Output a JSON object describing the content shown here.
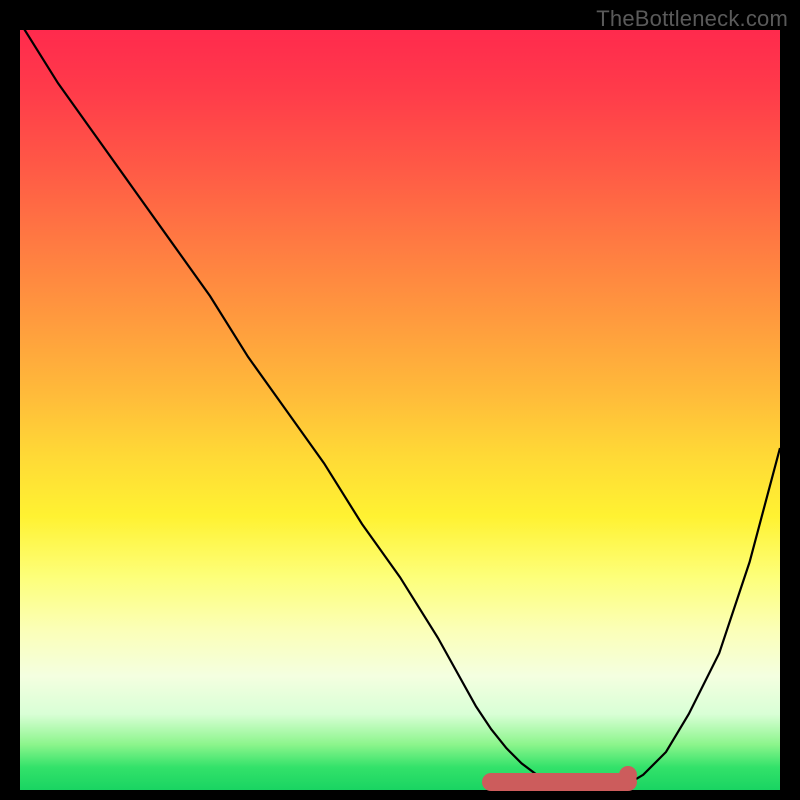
{
  "attribution": "TheBottleneck.com",
  "chart_data": {
    "type": "line",
    "title": "",
    "xlabel": "",
    "ylabel": "",
    "xlim": [
      0,
      100
    ],
    "ylim": [
      0,
      100
    ],
    "series": [
      {
        "name": "bottleneck-curve",
        "x": [
          0,
          5,
          10,
          15,
          20,
          25,
          30,
          35,
          40,
          45,
          50,
          55,
          60,
          62,
          64,
          66,
          68,
          70,
          72,
          74,
          76,
          78,
          80,
          82,
          85,
          88,
          92,
          96,
          100
        ],
        "y": [
          101,
          93,
          86,
          79,
          72,
          65,
          57,
          50,
          43,
          35,
          28,
          20,
          11,
          8,
          5.5,
          3.5,
          2,
          1,
          0.4,
          0.1,
          0,
          0.2,
          0.8,
          2,
          5,
          10,
          18,
          30,
          45
        ]
      }
    ],
    "optimal_range": {
      "start_x": 62,
      "end_x": 80,
      "y": 1
    },
    "optimal_dot": {
      "x": 80,
      "y": 2
    }
  },
  "colors": {
    "curve": "#000000",
    "marker": "#cc5c5c"
  }
}
